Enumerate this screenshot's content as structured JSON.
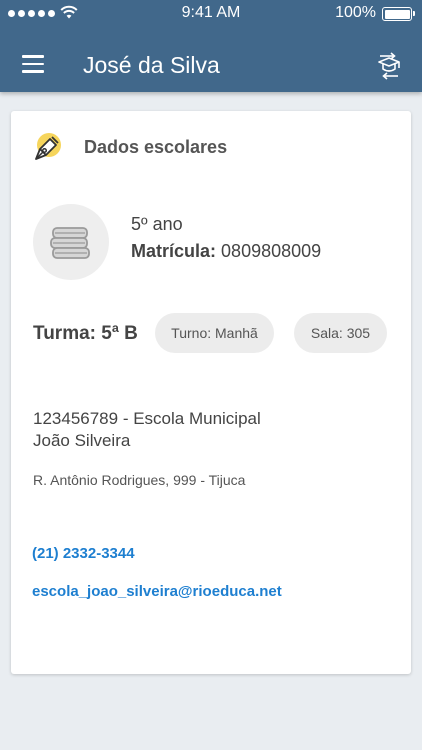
{
  "status_bar": {
    "time": "9:41 AM",
    "battery": "100%"
  },
  "header": {
    "title": "José da Silva",
    "menu_icon": "hamburger-menu-icon",
    "switch_icon": "switch-student-graduation-icon"
  },
  "card": {
    "section_title": "Dados escolares",
    "section_icon": "pen-nib-icon",
    "avatar_icon": "books-icon",
    "grade": "5º ano",
    "enrollment_label": "Matrícula:",
    "enrollment_value": "0809808009",
    "class_name": "Turma: 5ª B",
    "shift": "Turno: Manhã",
    "room": "Sala: 305",
    "school_line1": "123456789 - Escola Municipal",
    "school_line2": "João Silveira",
    "address": "R. Antônio Rodrigues, 999 - Tijuca",
    "phone": "(21) 2332-3344",
    "email": "escola_joao_silveira@rioeduca.net"
  },
  "colors": {
    "header": "#41688b",
    "link": "#1e7fd0",
    "background": "#e9edf1",
    "icon_accent": "#f6d55c"
  }
}
